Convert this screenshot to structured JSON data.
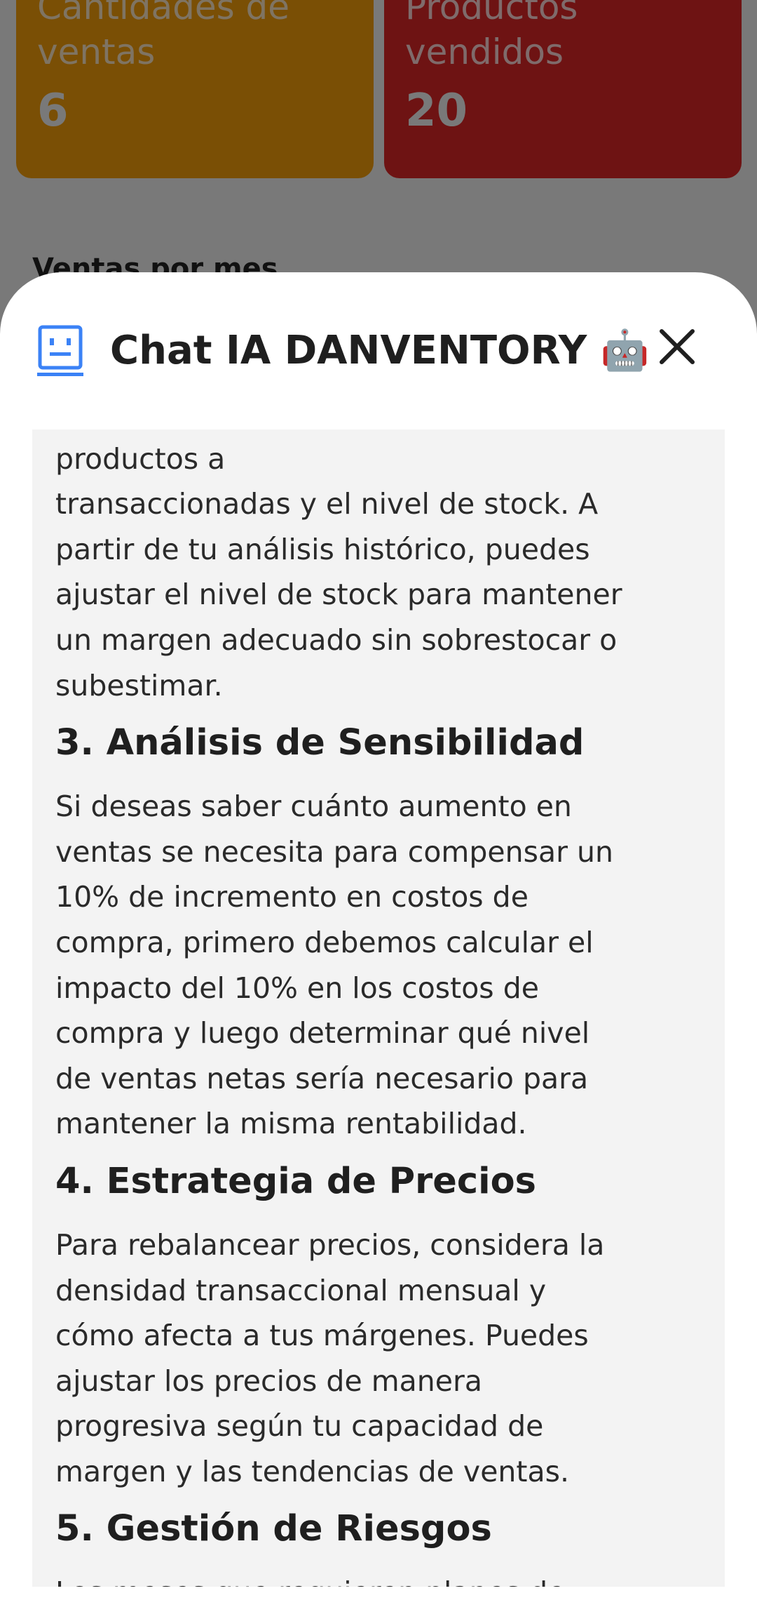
{
  "background": {
    "cards": [
      {
        "label": "Cantidades de\nventas",
        "value": "6",
        "color": "#f59e0b"
      },
      {
        "label": "Productos\nvendidos",
        "value": "20",
        "color": "#dc2626"
      }
    ],
    "section_title": "Ventas por mes"
  },
  "chat": {
    "title": "Chat IA DANVENTORY 🤖",
    "header_icon": "robot-face-icon",
    "close_icon": "close-icon",
    "accent_color": "#3b82f6",
    "blocks": [
      {
        "type": "p",
        "text": "Los meses con más ventas requieren más productos a\ntransaccionadas y el nivel de stock. A\npartir de tu análisis histórico, puedes\najustar el nivel de stock para mantener\nun margen adecuado sin sobrestocar o\nsubestimar."
      },
      {
        "type": "h",
        "text": "3. Análisis de Sensibilidad"
      },
      {
        "type": "p",
        "text": "Si deseas saber cuánto aumento en\nventas se necesita para compensar un\n10% de incremento en costos de\ncompra, primero debemos calcular el\nimpacto del 10% en los costos de\ncompra y luego determinar qué nivel\nde ventas netas sería necesario para\nmantener la misma rentabilidad."
      },
      {
        "type": "h",
        "text": "4. Estrategia de Precios"
      },
      {
        "type": "p",
        "text": "Para rebalancear precios, considera la\ndensidad transaccional mensual y\ncómo afecta a tus márgenes. Puedes\najustar los precios de manera\nprogresiva según tu capacidad de\nmargen y las tendencias de ventas."
      },
      {
        "type": "h",
        "text": "5. Gestión de Riesgos"
      },
      {
        "type": "p",
        "text": "Los meses que requieren planes de"
      }
    ]
  }
}
